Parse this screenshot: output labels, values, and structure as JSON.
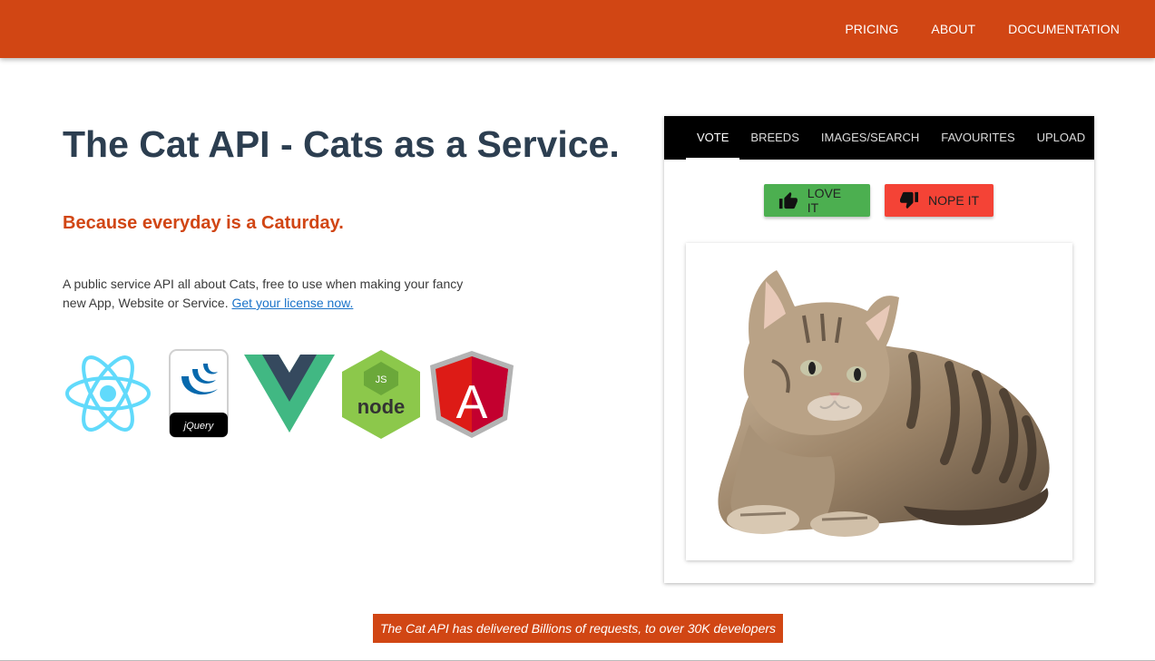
{
  "nav": {
    "items": [
      "PRICING",
      "ABOUT",
      "DOCUMENTATION"
    ]
  },
  "hero": {
    "title_bold": "The Cat API -",
    "title_rest": " Cats as a Service.",
    "tagline": "Because everyday is a Caturday.",
    "description": "A public service API all about Cats, free to use when making your fancy new App, Website or Service. ",
    "license_link": "Get your license now."
  },
  "logos": {
    "items": [
      "react-logo",
      "jquery-logo",
      "vue-logo",
      "node-logo",
      "angular-logo"
    ],
    "jquery_text": "jQuery",
    "node_text": "node",
    "node_js": "JS",
    "angular_letter": "A"
  },
  "panel": {
    "tabs": [
      "VOTE",
      "BREEDS",
      "IMAGES/SEARCH",
      "FAVOURITES",
      "UPLOAD"
    ],
    "active_tab": "VOTE",
    "love_label": "LOVE IT",
    "nope_label": "NOPE IT"
  },
  "banner": {
    "text": "The Cat API has delivered Billions of requests, to over 30K developers"
  },
  "colors": {
    "brand": "#d14614",
    "love": "#4caf50",
    "nope": "#f44336",
    "title": "#2c3e50"
  }
}
